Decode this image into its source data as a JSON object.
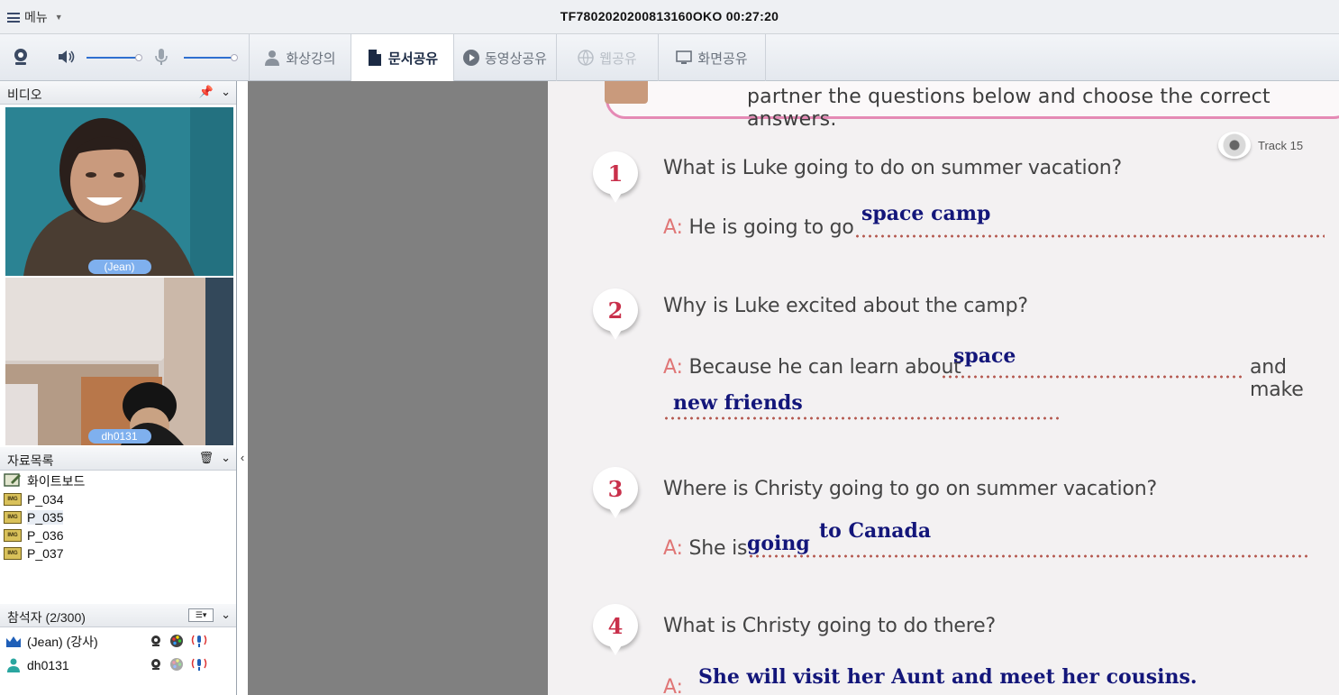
{
  "titlebar": {
    "menu_label": "메뉴",
    "session_title": "TF7802020200813160OKO 00:27:20"
  },
  "toolbar": {
    "tabs": [
      {
        "label": "화상강의",
        "icon": "person-icon",
        "state": "normal"
      },
      {
        "label": "문서공유",
        "icon": "document-icon",
        "state": "active"
      },
      {
        "label": "동영상공유",
        "icon": "play-icon",
        "state": "normal"
      },
      {
        "label": "웹공유",
        "icon": "globe-icon",
        "state": "disabled"
      },
      {
        "label": "화면공유",
        "icon": "monitor-icon",
        "state": "normal"
      }
    ],
    "speaker_volume": 0.85,
    "mic_volume": 0.85
  },
  "video_panel": {
    "title": "비디오",
    "tiles": [
      {
        "name": "(Jean)"
      },
      {
        "name": "dh0131"
      }
    ]
  },
  "materials_panel": {
    "title": "자료목록",
    "items": [
      {
        "label": "화이트보드",
        "icon": "whiteboard-icon",
        "selected": false
      },
      {
        "label": "P_034",
        "icon": "image-file-icon",
        "selected": false
      },
      {
        "label": "P_035",
        "icon": "image-file-icon",
        "selected": true
      },
      {
        "label": "P_036",
        "icon": "image-file-icon",
        "selected": false
      },
      {
        "label": "P_037",
        "icon": "image-file-icon",
        "selected": false
      }
    ],
    "img_badge": "IMG"
  },
  "participants_panel": {
    "title": "참석자 (2/300)",
    "rows": [
      {
        "name": "(Jean) (강사)",
        "role_icon": "crown-icon"
      },
      {
        "name": "dh0131",
        "role_icon": "person-icon"
      }
    ]
  },
  "document": {
    "banner_text": "partner the questions below and choose the correct answers.",
    "track_label": "Track 15",
    "questions": [
      {
        "number": "1",
        "question": "What is Luke going to do on summer vacation?",
        "answer_prefix": "A:",
        "answer_text": "He is going to go",
        "handwriting": "space camp"
      },
      {
        "number": "2",
        "question": "Why is Luke excited about the camp?",
        "answer_prefix": "A:",
        "answer_text": "Because he can learn about",
        "answer_suffix": "and make",
        "handwriting": "space",
        "handwriting_2": "new friends"
      },
      {
        "number": "3",
        "question": "Where is Christy going to go on summer vacation?",
        "answer_prefix": "A:",
        "answer_text": "She is",
        "handwriting": "going",
        "handwriting_2": "to Canada"
      },
      {
        "number": "4",
        "question": "What is Christy going to do there?",
        "answer_prefix": "A:",
        "handwriting": "She will visit her Aunt and meet her cousins."
      }
    ],
    "colors": {
      "badge_number": "#c9304b",
      "handwriting": "#13167a",
      "dotted_line": "#b4584f",
      "banner_border": "#e58ab5"
    }
  }
}
